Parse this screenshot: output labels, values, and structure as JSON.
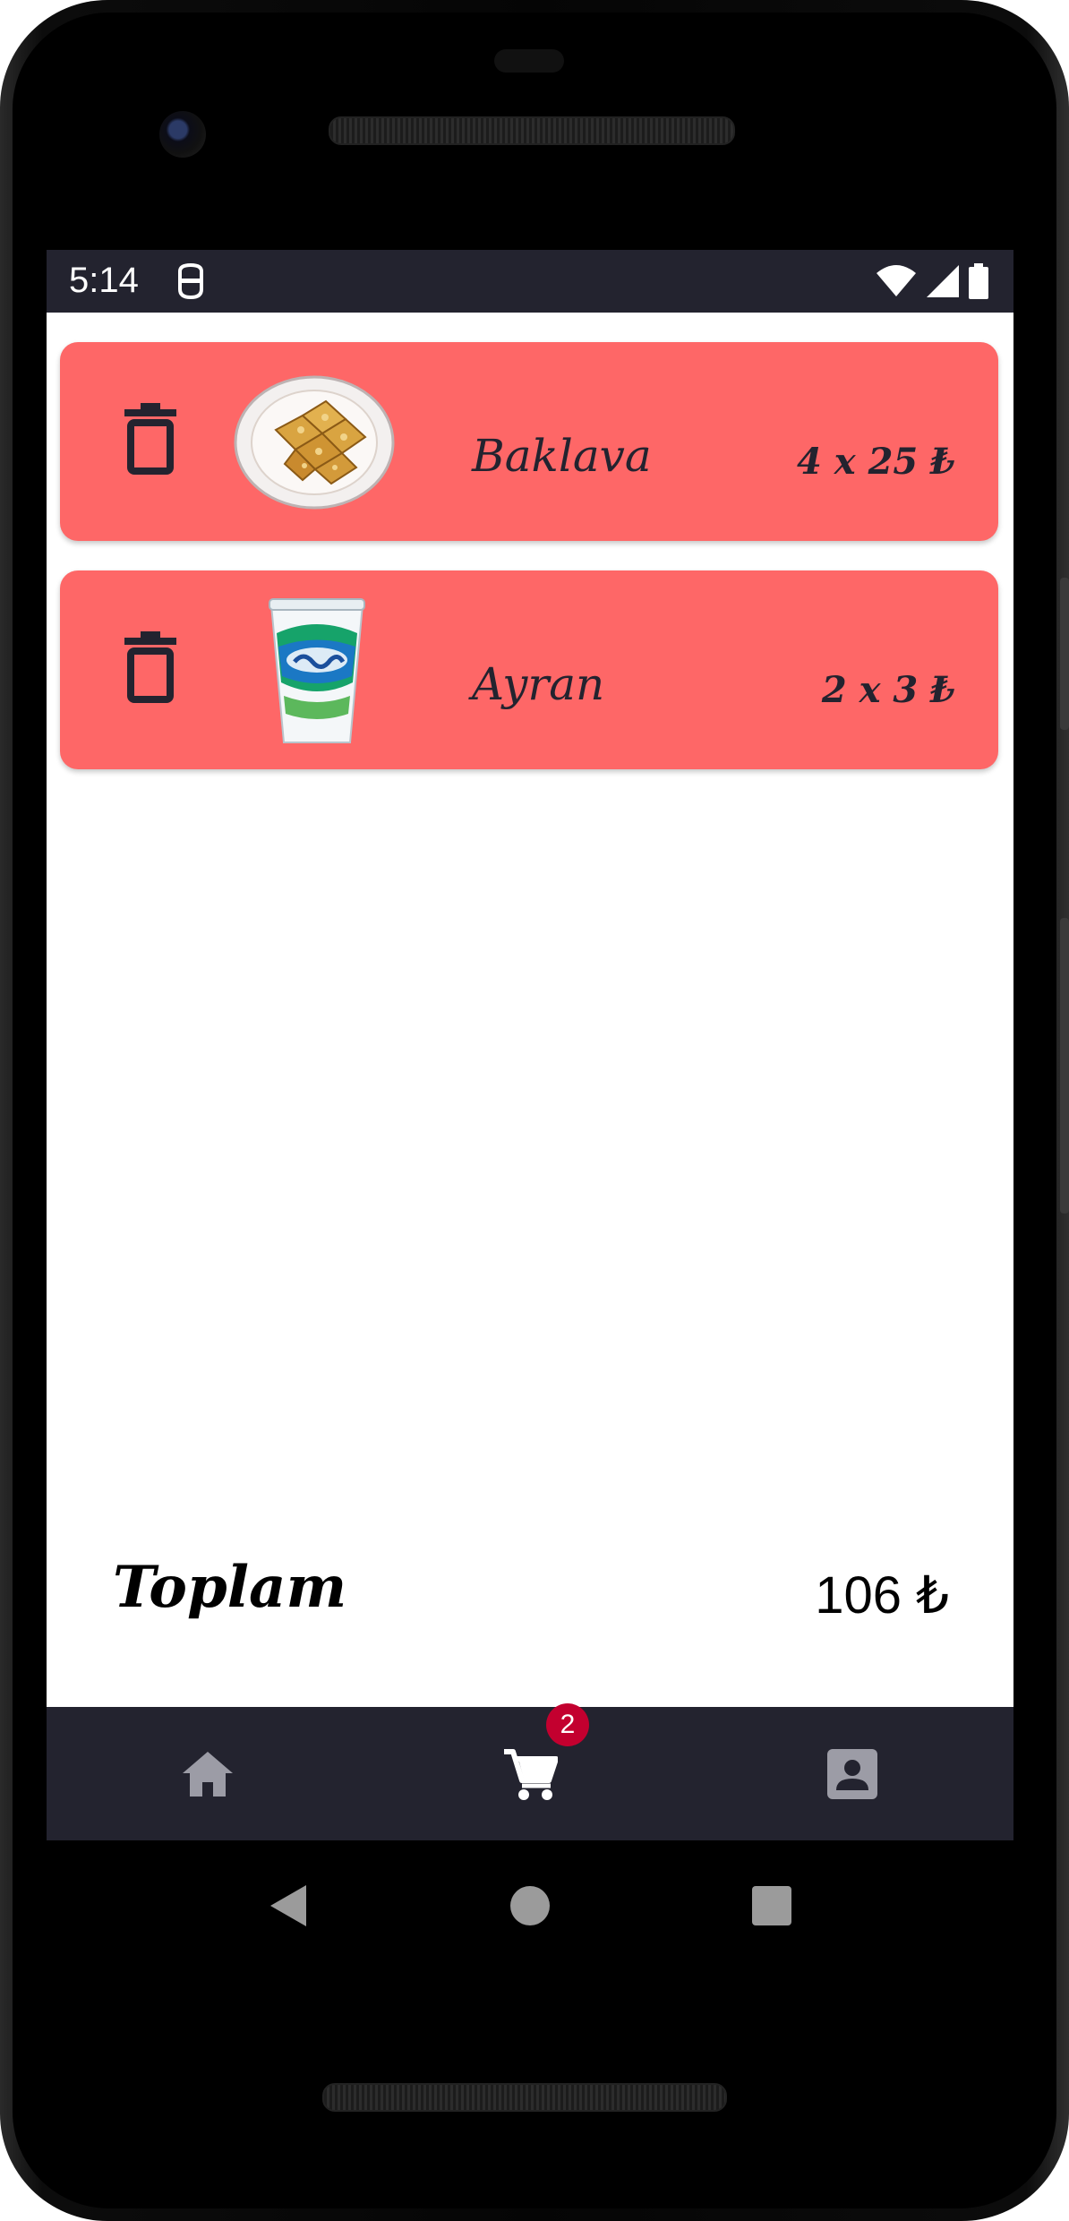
{
  "status_bar": {
    "time": "5:14",
    "icons": [
      "app-notification-icon",
      "wifi-icon",
      "signal-icon",
      "battery-icon"
    ]
  },
  "cart": {
    "items": [
      {
        "name": "Baklava",
        "quantity_price": "4 x 25 ₺",
        "image": "baklava-image"
      },
      {
        "name": "Ayran",
        "quantity_price": "2 x 3 ₺",
        "image": "ayran-cup-image"
      }
    ],
    "total_label": "Toplam",
    "total_value": "106 ₺"
  },
  "bottom_nav": {
    "items": [
      "home-icon",
      "cart-icon",
      "profile-icon"
    ],
    "cart_badge": "2",
    "active": "cart"
  },
  "colors": {
    "card": "#fe6767",
    "bars": "#23232f",
    "badge": "#c3002f"
  }
}
